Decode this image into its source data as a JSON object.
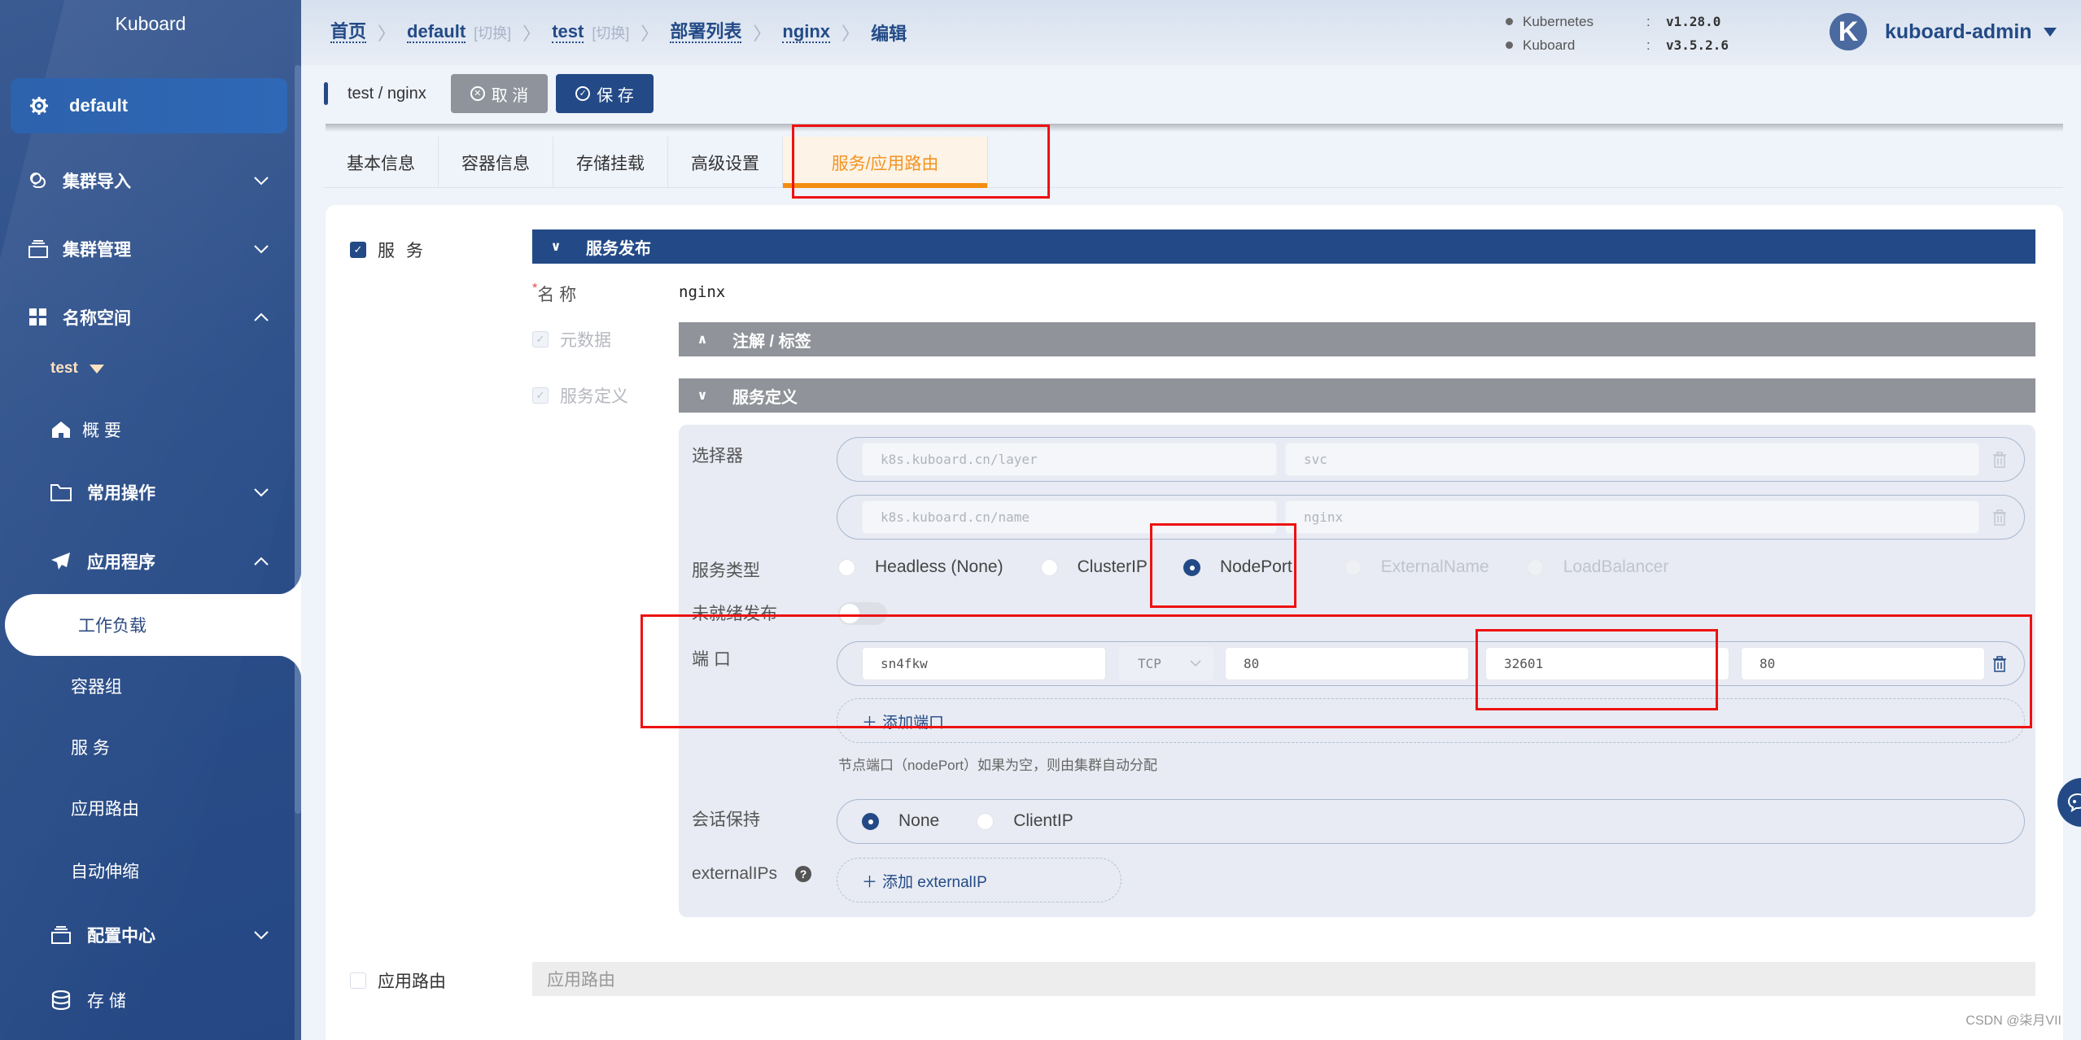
{
  "sidebar": {
    "logo": "Kuboard",
    "cluster": {
      "label": "default",
      "icon": "cluster-gear-icon"
    },
    "groups": [
      {
        "label": "集群导入",
        "icon": "link-icon",
        "expanded": false
      },
      {
        "label": "集群管理",
        "icon": "stack-icon",
        "expanded": false
      },
      {
        "label": "名称空间",
        "icon": "grid-icon",
        "expanded": true
      }
    ],
    "namespace": "test",
    "ns_items": [
      {
        "label": "概 要",
        "icon": "home-icon"
      },
      {
        "label": "常用操作",
        "icon": "folder-icon",
        "expanded": false
      },
      {
        "label": "应用程序",
        "icon": "paper-plane-icon",
        "expanded": true
      }
    ],
    "app_items": [
      "工作负载",
      "容器组",
      "服 务",
      "应用路由",
      "自动伸缩"
    ],
    "active_item": "工作负载",
    "bottom_items": [
      {
        "label": "配置中心",
        "icon": "stack-icon",
        "expanded": false
      },
      {
        "label": "存 储",
        "icon": "database-icon"
      }
    ]
  },
  "header": {
    "breadcrumb": [
      {
        "label": "首页"
      },
      {
        "label": "default",
        "switch": "[切换]"
      },
      {
        "label": "test",
        "switch": "[切换]"
      },
      {
        "label": "部署列表"
      },
      {
        "label": "nginx"
      }
    ],
    "breadcrumb_current": "编辑",
    "versions": [
      {
        "name": "Kubernetes",
        "value": "v1.28.0"
      },
      {
        "name": "Kuboard",
        "value": "v3.5.2.6"
      }
    ],
    "user": {
      "avatar_letter": "K",
      "name": "kuboard-admin"
    }
  },
  "toolbar": {
    "title": "test / nginx",
    "cancel_label": "取 消",
    "save_label": "保 存"
  },
  "tabs": [
    {
      "label": "基本信息",
      "active": false
    },
    {
      "label": "容器信息",
      "active": false
    },
    {
      "label": "存储挂载",
      "active": false
    },
    {
      "label": "高级设置",
      "active": false
    },
    {
      "label": "服务/应用路由",
      "active": true
    }
  ],
  "service": {
    "enabled_label": "服 务",
    "enabled": true,
    "section_title": "服务发布",
    "name_label": "名 称",
    "name_value": "nginx",
    "metadata_label": "元数据",
    "metadata_section": "注解 / 标签",
    "definition_label": "服务定义",
    "definition_section": "服务定义",
    "selector_label": "选择器",
    "selectors": [
      {
        "key": "k8s.kuboard.cn/layer",
        "value": "svc"
      },
      {
        "key": "k8s.kuboard.cn/name",
        "value": "nginx"
      }
    ],
    "type_label": "服务类型",
    "types": [
      {
        "label": "Headless (None)",
        "state": "off"
      },
      {
        "label": "ClusterIP",
        "state": "off"
      },
      {
        "label": "NodePort",
        "state": "on"
      },
      {
        "label": "ExternalName",
        "state": "disabled"
      },
      {
        "label": "LoadBalancer",
        "state": "disabled"
      }
    ],
    "unready_label": "未就绪发布",
    "unready_enabled": false,
    "ports_label": "端 口",
    "ports": [
      {
        "name": "sn4fkw",
        "protocol": "TCP",
        "port": "80",
        "node_port": "32601",
        "target_port": "80"
      }
    ],
    "add_port_label": "添加端口",
    "nodeport_hint": "节点端口（nodePort）如果为空，则由集群自动分配",
    "session_label": "会话保持",
    "session_options": [
      {
        "label": "None",
        "state": "on"
      },
      {
        "label": "ClientIP",
        "state": "off"
      }
    ],
    "external_ips_label": "externalIPs",
    "add_external_ip_label": "添加 externalIP"
  },
  "ingress": {
    "enabled_label": "应用路由",
    "enabled": false,
    "section_title": "应用路由"
  },
  "watermark": "CSDN @柒月VII",
  "colors": {
    "primary": "#234a86",
    "accent": "#f38c10",
    "highlight": "#ee1111"
  }
}
